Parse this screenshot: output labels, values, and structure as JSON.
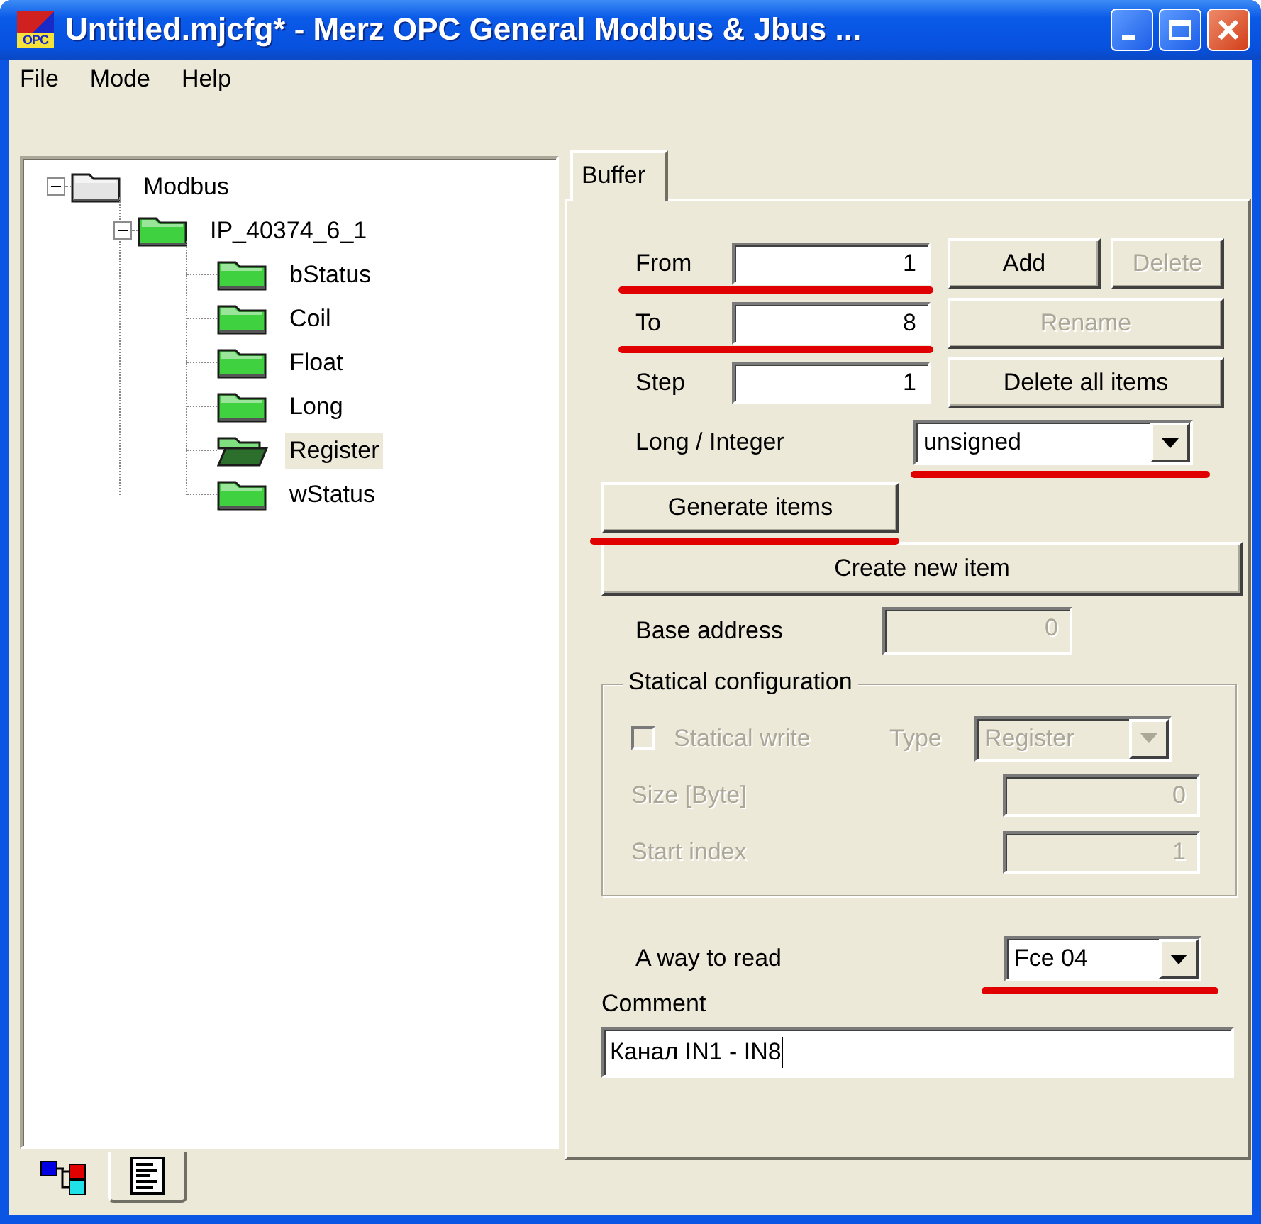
{
  "window": {
    "title": "Untitled.mjcfg* - Merz OPC General Modbus & Jbus ...",
    "icon_text": "OPC"
  },
  "menu": [
    {
      "label": "File"
    },
    {
      "label": "Mode"
    },
    {
      "label": "Help"
    }
  ],
  "tree": [
    {
      "label": "Modbus",
      "expanded": true,
      "selected": false,
      "children": [
        {
          "label": "IP_40374_6_1",
          "expanded": true,
          "selected": false,
          "children": [
            {
              "label": "bStatus",
              "selected": false
            },
            {
              "label": "Coil",
              "selected": false
            },
            {
              "label": "Float",
              "selected": false
            },
            {
              "label": "Long",
              "selected": false
            },
            {
              "label": "Register",
              "selected": true
            },
            {
              "label": "wStatus",
              "selected": false
            }
          ]
        }
      ]
    }
  ],
  "tabs": [
    {
      "label": "Buffer",
      "selected": true
    }
  ],
  "buffer": {
    "fields": [
      {
        "label": "From",
        "value": "1",
        "highlighted": true
      },
      {
        "label": "To",
        "value": "8",
        "highlighted": true
      },
      {
        "label": "Step",
        "value": "1",
        "highlighted": false
      }
    ],
    "buttons": [
      {
        "label": "Add",
        "disabled": false
      },
      {
        "label": "Delete",
        "disabled": true
      },
      {
        "label": "Rename",
        "disabled": true
      },
      {
        "label": "Delete all items",
        "disabled": false
      }
    ],
    "long_integer": {
      "label": "Long / Integer",
      "value": "unsigned",
      "highlighted": true
    },
    "generate_button": {
      "label": "Generate items",
      "highlighted": true
    },
    "create_button": {
      "label": "Create new item"
    },
    "base_address": {
      "label": "Base address",
      "value": "0",
      "disabled": true
    },
    "statical": {
      "title": "Statical configuration",
      "write": {
        "label": "Statical write",
        "checked": false,
        "disabled": true
      },
      "type": {
        "label": "Type",
        "value": "Register",
        "disabled": true
      },
      "size": {
        "label": "Size [Byte]",
        "value": "0",
        "disabled": true
      },
      "start_index": {
        "label": "Start index",
        "value": "1",
        "disabled": true
      }
    },
    "read_mode": {
      "label": "A way to read",
      "value": "Fce 04",
      "highlighted": true
    },
    "comment": {
      "label": "Comment",
      "value": "Канал IN1 - IN8"
    }
  },
  "bottom_tabs": [
    {
      "kind": "tree",
      "selected": true
    },
    {
      "kind": "document",
      "selected": false
    }
  ]
}
